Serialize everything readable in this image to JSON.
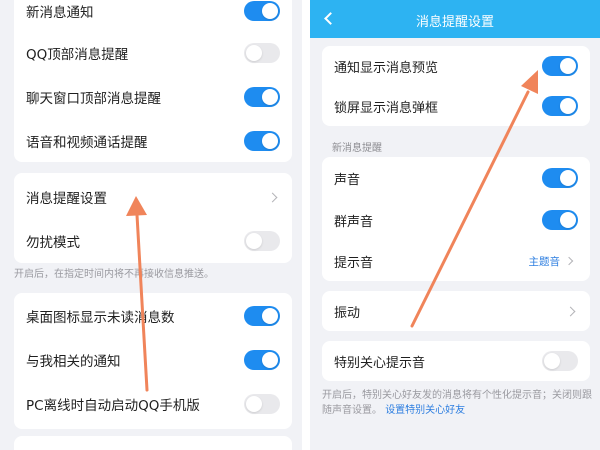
{
  "left": {
    "card1": [
      {
        "label": "新消息通知",
        "on": true
      },
      {
        "label": "QQ顶部消息提醒",
        "on": false
      },
      {
        "label": "聊天窗口顶部消息提醒",
        "on": true
      },
      {
        "label": "语音和视频通话提醒",
        "on": true
      }
    ],
    "card2": {
      "settings_label": "消息提醒设置",
      "dnd_label": "勿扰模式",
      "dnd_on": false
    },
    "dnd_note": "开启后，在指定时间内将不再接收信息推送。",
    "card3": [
      {
        "label": "桌面图标显示未读消息数",
        "on": true
      },
      {
        "label": "与我相关的通知",
        "on": true
      },
      {
        "label": "PC离线时自动启动QQ手机版",
        "on": false
      }
    ]
  },
  "right": {
    "header": {
      "title": "消息提醒设置"
    },
    "card1": [
      {
        "label": "通知显示消息预览",
        "on": true
      },
      {
        "label": "锁屏显示消息弹框",
        "on": true
      }
    ],
    "section_title": "新消息提醒",
    "card2": {
      "sound_label": "声音",
      "sound_on": true,
      "group_sound_label": "群声音",
      "group_sound_on": true,
      "tone_label": "提示音",
      "tone_value": "主题音"
    },
    "vibrate_label": "振动",
    "special_label": "特别关心提示音",
    "special_on": false,
    "special_note": "开启后，特别关心好友发的消息将有个性化提示音；关闭则跟随声音设置。",
    "special_link": "设置特别关心好友"
  },
  "colors": {
    "accent": "#1e8cf0",
    "header": "#2db3f2",
    "arrow": "#f0845a"
  }
}
